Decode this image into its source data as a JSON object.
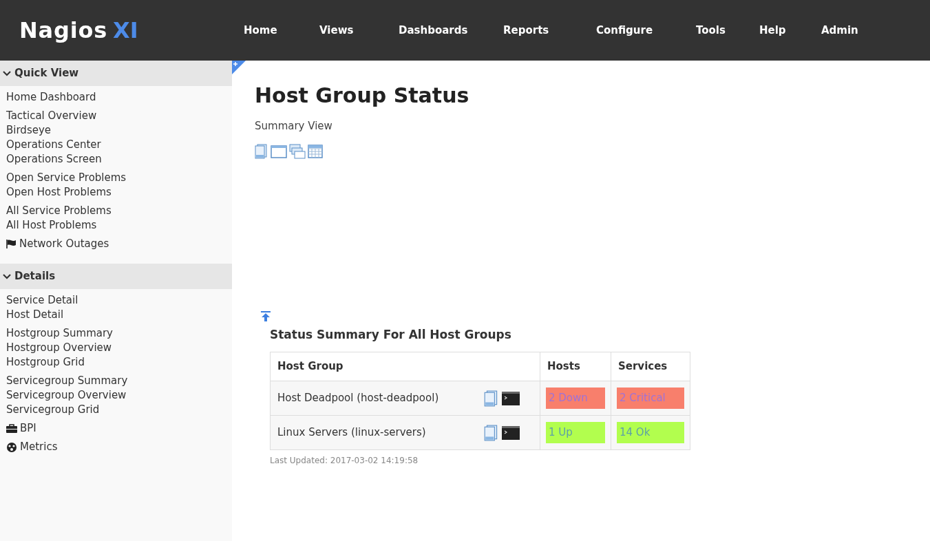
{
  "header": {
    "logo_text": "Nagios",
    "logo_suffix": "XI",
    "nav": [
      {
        "label": "Home"
      },
      {
        "label": "Views"
      },
      {
        "label": "Dashboards"
      },
      {
        "label": "Reports"
      },
      {
        "label": "Configure"
      },
      {
        "label": "Tools"
      },
      {
        "label": "Help"
      },
      {
        "label": "Admin"
      }
    ]
  },
  "sidebar": {
    "sections": [
      {
        "title": "Quick View",
        "expanded": true,
        "groups": [
          [
            {
              "label": "Home Dashboard",
              "kind": "plain"
            }
          ],
          [
            {
              "label": "Tactical Overview",
              "kind": "plain"
            },
            {
              "label": "Birdseye",
              "kind": "plain"
            },
            {
              "label": "Operations Center",
              "kind": "plain"
            },
            {
              "label": "Operations Screen",
              "kind": "plain"
            }
          ],
          [
            {
              "label": "Open Service Problems",
              "kind": "plain"
            },
            {
              "label": "Open Host Problems",
              "kind": "plain"
            }
          ],
          [
            {
              "label": "All Service Problems",
              "kind": "plain"
            },
            {
              "label": "All Host Problems",
              "kind": "plain"
            }
          ],
          [
            {
              "label": "Network Outages",
              "kind": "flag"
            }
          ]
        ]
      },
      {
        "title": "Details",
        "expanded": true,
        "groups": [
          [
            {
              "label": "Service Detail",
              "kind": "plain"
            },
            {
              "label": "Host Detail",
              "kind": "plain"
            }
          ],
          [
            {
              "label": "Hostgroup Summary",
              "kind": "plain"
            },
            {
              "label": "Hostgroup Overview",
              "kind": "plain"
            },
            {
              "label": "Hostgroup Grid",
              "kind": "plain"
            }
          ],
          [
            {
              "label": "Servicegroup Summary",
              "kind": "plain"
            },
            {
              "label": "Servicegroup Overview",
              "kind": "plain"
            },
            {
              "label": "Servicegroup Grid",
              "kind": "plain"
            }
          ],
          [
            {
              "label": "BPI",
              "kind": "briefcase"
            }
          ],
          [
            {
              "label": "Metrics",
              "kind": "gauge"
            }
          ]
        ]
      }
    ]
  },
  "main": {
    "title": "Host Group Status",
    "subtitle": "Summary View",
    "summary": {
      "title": "Status Summary For All Host Groups",
      "columns": [
        "Host Group",
        "Hosts",
        "Services"
      ],
      "rows": [
        {
          "name": "Host Deadpool (host-deadpool)",
          "hosts": {
            "text": "2 Down",
            "color": "#f87f6c"
          },
          "services": {
            "text": "2 Critical",
            "color": "#f87f6c"
          }
        },
        {
          "name": "Linux Servers (linux-servers)",
          "hosts": {
            "text": "1 Up",
            "color": "#b2fe4e"
          },
          "services": {
            "text": "14 Ok",
            "color": "#b2fe4e"
          }
        }
      ],
      "last_updated": "Last Updated: 2017-03-02 14:19:58"
    }
  }
}
